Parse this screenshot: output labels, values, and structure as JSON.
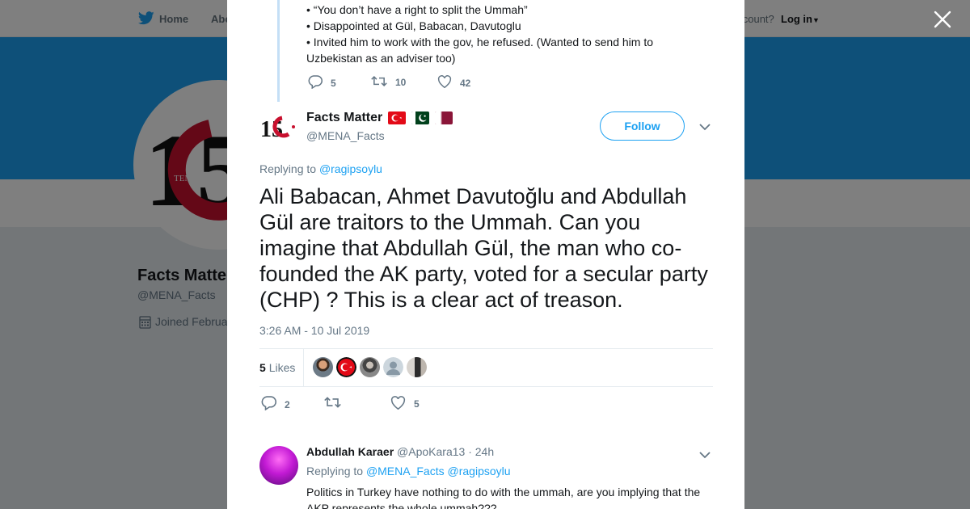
{
  "nav": {
    "home_label": "Home",
    "about_label": "Abo",
    "account_prompt": "account?",
    "login_label": "Log in"
  },
  "background_profile": {
    "name": "Facts Matte",
    "handle": "@MENA_Facts",
    "joined": "Joined Februa",
    "avatar_number": "15",
    "avatar_caption": "TEMMUZ"
  },
  "previous_tweet": {
    "lines": [
      "• “You don’t have a right to split the Ummah”",
      "• Disappointed at Gül, Babacan, Davutoglu",
      "• Invited him to work with the gov, he refused. (Wanted to send him to Uzbekistan as an adviser too)"
    ],
    "replies": "5",
    "retweets": "10",
    "likes": "42"
  },
  "tweet": {
    "author_name": "Facts Matter",
    "handle": "@MENA_Facts",
    "follow_label": "Follow",
    "replying_prefix": "Replying to",
    "replying_to": "@ragipsoylu",
    "text": "Ali Babacan, Ahmet Davutoğlu and Abdullah Gül are traitors to the Ummah. Can you imagine that Abdullah Gül, the man who co-founded the AK party, voted for a secular party (CHP) ? This is a clear act of treason.",
    "timestamp": "3:26 AM - 10 Jul 2019",
    "likes_count": "5",
    "likes_label": "Likes",
    "replies": "2",
    "retweets": "",
    "likes": "5",
    "avatar_number": "15"
  },
  "reply": {
    "author_name": "Abdullah Karaer",
    "handle": "@ApoKara13",
    "time": "· 24h",
    "replying_prefix": "Replying to",
    "replying_to_1": "@MENA_Facts",
    "replying_to_2": "@ragipsoylu",
    "text": "Politics in Turkey have nothing to do with the ummah, are you implying that the AKP represents the whole ummah???"
  },
  "colors": {
    "accent": "#1da1f2",
    "banner": "#1da1f2",
    "thread_line": "#c4dff6",
    "text_secondary": "#657786"
  }
}
